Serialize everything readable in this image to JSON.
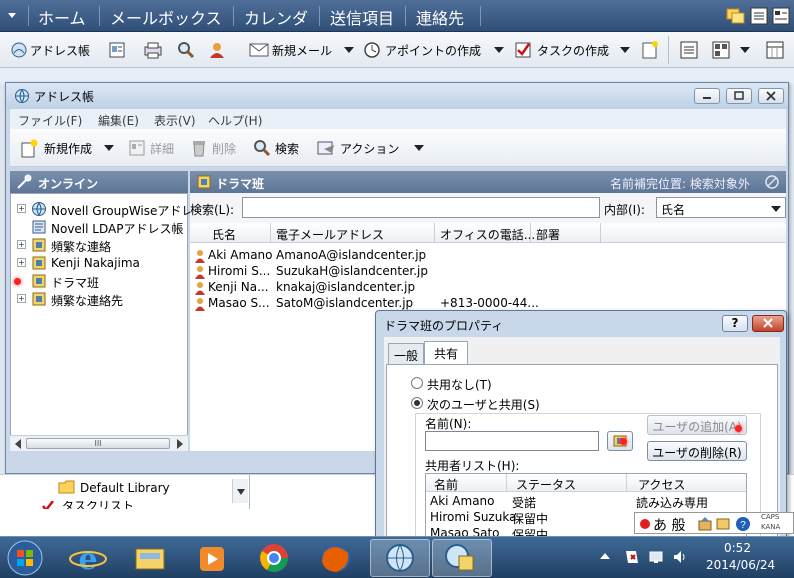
{
  "navbar": {
    "items": [
      "ホーム",
      "メールボックス",
      "カレンダ",
      "送信項目",
      "連絡先"
    ]
  },
  "app_toolbar": {
    "address_book": "アドレス帳",
    "new_mail": "新規メール",
    "new_appointment": "アポイントの作成",
    "new_task": "タスクの作成"
  },
  "window": {
    "title": "アドレス帳",
    "menus": [
      "ファイル(F)",
      "編集(E)",
      "表示(V)",
      "ヘルプ(H)"
    ],
    "toolbar": {
      "new": "新規作成",
      "details": "詳細",
      "delete": "削除",
      "search": "検索",
      "action": "アクション"
    },
    "left_pane": {
      "header": "オンライン",
      "tree": [
        {
          "label": "Novell GroupWiseアドレ",
          "expandable": true
        },
        {
          "label": "Novell LDAPアドレス帳",
          "expandable": false
        },
        {
          "label": "頻繁な連絡",
          "expandable": true
        },
        {
          "label": "Kenji Nakajima",
          "expandable": true
        },
        {
          "label": "ドラマ班",
          "expandable": false
        },
        {
          "label": "頻繁な連絡先",
          "expandable": true
        }
      ],
      "scroll_label": "III"
    },
    "right_pane": {
      "header": "ドラマ班",
      "name_completion": "名前補完位置: 検索対象外",
      "search_label": "検索(L):",
      "search_value": "",
      "within_label": "内部(I):",
      "within_value": "氏名",
      "columns": [
        "氏名",
        "電子メールアドレス",
        "オフィスの電話...",
        "部署"
      ],
      "rows": [
        {
          "name": "Aki Amano",
          "email": "AmanoA@islandcenter.jp",
          "phone": ""
        },
        {
          "name": "Hiromi S...",
          "email": "SuzukaH@islandcenter.jp",
          "phone": ""
        },
        {
          "name": "Kenji Na...",
          "email": "knakaj@islandcenter.jp",
          "phone": ""
        },
        {
          "name": "Masao S...",
          "email": "SatoM@islandcenter.jp",
          "phone": "+813-0000-44..."
        }
      ]
    }
  },
  "below_window": {
    "library": "Default Library",
    "task_list": "タスクリスト"
  },
  "dialog": {
    "title": "ドラマ班のプロパティ",
    "help": "?",
    "tabs": [
      "一般",
      "共有"
    ],
    "active_tab": "共有",
    "radio_no_share": "共用なし(T)",
    "radio_share_with": "次のユーザと共用(S)",
    "name_label": "名前(N):",
    "name_value": "",
    "add_user": "ユーザの追加(A)",
    "remove_user": "ユーザの削除(R)",
    "share_list_label": "共用者リスト(H):",
    "share_columns": [
      "名前",
      "ステータス",
      "アクセス"
    ],
    "share_rows": [
      {
        "name": "Aki Amano",
        "status": "受諾",
        "access": "読み込み専用"
      },
      {
        "name": "Hiromi Suzuka",
        "status": "保留中",
        "access": ""
      },
      {
        "name": "Masao Sato",
        "status": "保留中",
        "access": ""
      }
    ]
  },
  "ime": {
    "mode": "あ 般",
    "caps": "CAPS",
    "kana": "KANA"
  },
  "clock": {
    "time": "0:52",
    "date": "2014/06/24"
  },
  "colors": {
    "nav": "#3a5a85",
    "pane_header": "#6a819f",
    "taskbar": "#2c4f78",
    "dialog_frame": "#c8d8ea"
  },
  "icons": [
    "search-icon",
    "contact-icon",
    "mail-icon",
    "clock-icon",
    "task-icon",
    "folder-icon",
    "globe-icon"
  ]
}
